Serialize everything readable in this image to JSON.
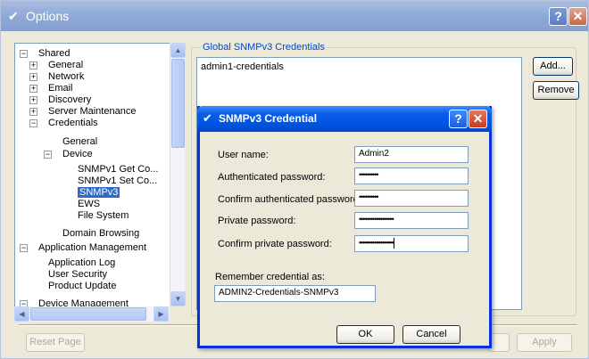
{
  "window": {
    "title": "Options",
    "help_label": "?",
    "close_label": "✕"
  },
  "tree": {
    "items": [
      {
        "label": "Shared",
        "exp": "−"
      },
      {
        "label": "General",
        "exp": "+"
      },
      {
        "label": "Network",
        "exp": "+"
      },
      {
        "label": "Email",
        "exp": "+"
      },
      {
        "label": "Discovery",
        "exp": "+"
      },
      {
        "label": "Server Maintenance",
        "exp": "+"
      },
      {
        "label": "Credentials",
        "exp": "−"
      },
      {
        "label": "General"
      },
      {
        "label": "Device",
        "exp": "−"
      },
      {
        "label": "SNMPv1 Get Co..."
      },
      {
        "label": "SNMPv1 Set Co..."
      },
      {
        "label": "SNMPv3",
        "selected": true
      },
      {
        "label": "EWS"
      },
      {
        "label": "File System"
      },
      {
        "label": "Domain Browsing"
      },
      {
        "label": "Application Management",
        "exp": "−"
      },
      {
        "label": "Application Log"
      },
      {
        "label": "User Security"
      },
      {
        "label": "Product Update"
      },
      {
        "label": "Device Management",
        "exp": "−"
      }
    ]
  },
  "credentials_panel": {
    "group_title": "Global SNMPv3 Credentials",
    "list_items": [
      "admin1-credentials"
    ],
    "add_label": "Add...",
    "remove_label": "Remove"
  },
  "footer": {
    "reset_label": "Reset Page",
    "apply_label": "Apply"
  },
  "dialog": {
    "title": "SNMPv3 Credential",
    "help_label": "?",
    "close_label": "✕",
    "username_label": "User name:",
    "username_value": "Admin2",
    "auth_pw_label": "Authenticated password:",
    "auth_pw_value": "••••••••••",
    "confirm_auth_label": "Confirm authenticated password:",
    "confirm_auth_value": "••••••••••",
    "priv_pw_label": "Private password:",
    "priv_pw_value": "••••••••••••••••••",
    "confirm_priv_label": "Confirm private password:",
    "confirm_priv_value": "••••••••••••••••••",
    "remember_label": "Remember credential as:",
    "remember_value": "ADMIN2-Credentials-SNMPv3",
    "ok_label": "OK",
    "cancel_label": "Cancel"
  }
}
